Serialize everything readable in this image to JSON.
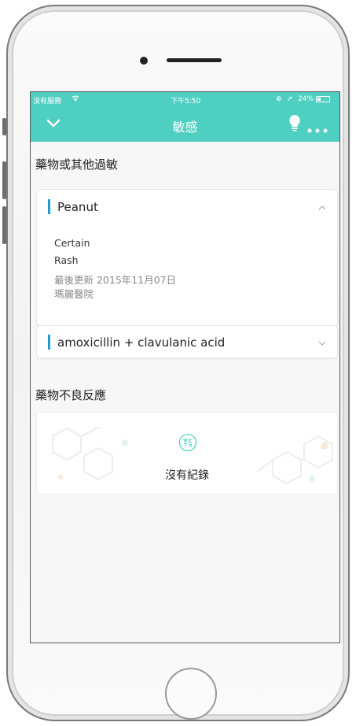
{
  "status_bar": {
    "carrier": "沒有服務",
    "time": "下午5:50",
    "battery": "24%"
  },
  "nav": {
    "title": "敏感",
    "back_icon": "chevron-down-icon",
    "tip_icon": "lightbulb-icon",
    "more_icon": "more-icon"
  },
  "allergy_section": {
    "title": "藥物或其他過敏",
    "items": [
      {
        "name": "Peanut",
        "expanded": true,
        "certainty": "Certain",
        "reaction": "Rash",
        "updated": "最後更新 2015年11月07日",
        "hospital": "瑪麗醫院"
      },
      {
        "name": "amoxicillin + clavulanic acid",
        "expanded": false
      }
    ]
  },
  "adr_section": {
    "title": "藥物不良反應",
    "empty_text": "沒有紀錄",
    "empty_icon": "no-record-icon"
  },
  "colors": {
    "header": "#4fcfc2",
    "accent_bar": "#1e9bd7"
  }
}
